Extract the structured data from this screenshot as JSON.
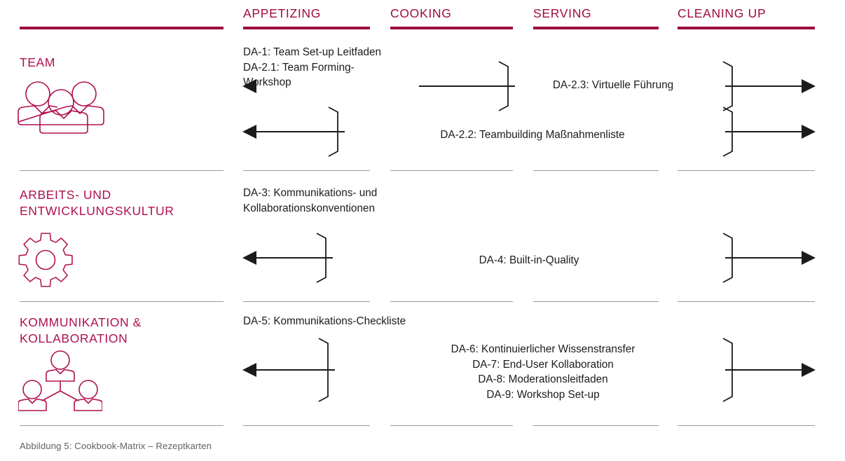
{
  "figure": {
    "caption": "Abbildung 5: Cookbook-Matrix – Rezeptkarten",
    "accent_color": "#9e0b41",
    "label_color": "#b01050",
    "rule_color": "#9b9b9b",
    "text_color": "#1b1b1b"
  },
  "columns": [
    {
      "id": "label",
      "label": ""
    },
    {
      "id": "appetizing",
      "label": "APPETIZING"
    },
    {
      "id": "cooking",
      "label": "COOKING"
    },
    {
      "id": "serving",
      "label": "SERVING"
    },
    {
      "id": "cleaning_up",
      "label": "CLEANING UP"
    }
  ],
  "rows": [
    {
      "id": "team",
      "label": "TEAM",
      "icon": "three-people-icon",
      "appetizing_text": "DA-1: Team Set-up Leitfaden\nDA-2.1: Team Forming-Workshop",
      "entries": [
        {
          "text": "DA-2.3: Virtuelle Führung"
        },
        {
          "text": "DA-2.2: Teambuilding Maßnahmenliste"
        }
      ]
    },
    {
      "id": "arbeits_entwicklungskultur",
      "label": "ARBEITS- UND\nENTWICKLUNGSKULTUR",
      "icon": "gear-icon",
      "appetizing_text": "DA-3: Kommunikations- und\nKollaborationskonventionen",
      "entries": [
        {
          "text": "DA-4: Built-in-Quality"
        }
      ]
    },
    {
      "id": "kommunikation_kollaboration",
      "label": "KOMMUNIKATION &\nKOLLABORATION",
      "icon": "org-people-icon",
      "appetizing_text": "DA-5: Kommunikations-Checkliste",
      "entries": [
        {
          "text": "DA-6: Kontinuierlicher Wissenstransfer\nDA-7: End-User Kollaboration\nDA-8: Moderationsleitfaden\nDA-9: Workshop Set-up"
        }
      ]
    }
  ]
}
